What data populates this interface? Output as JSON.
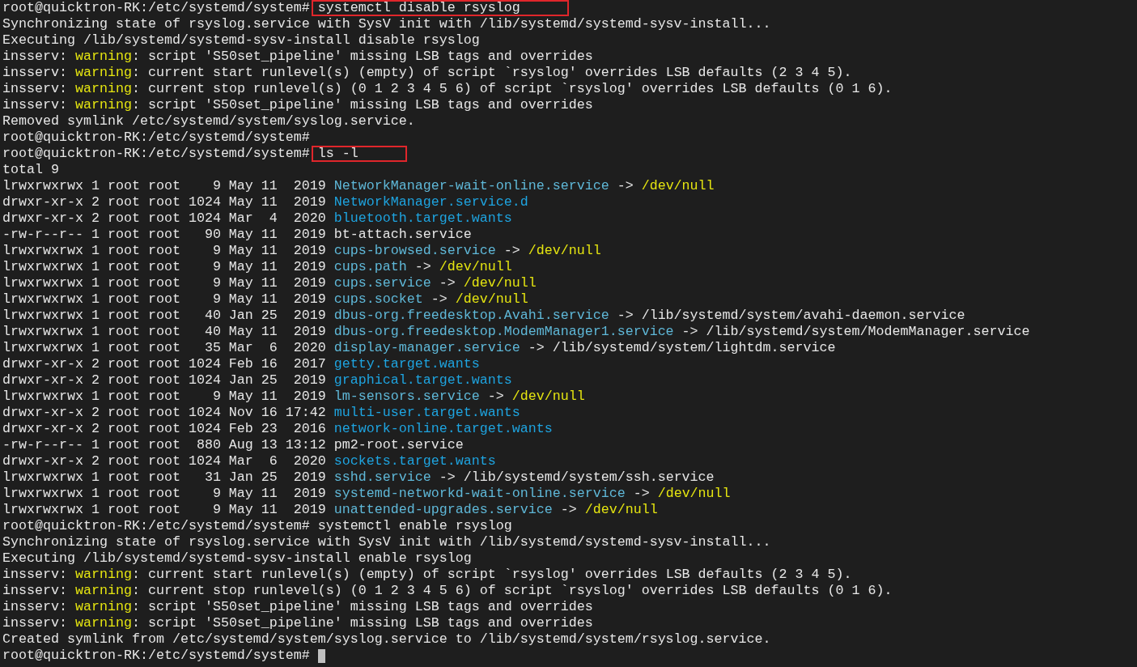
{
  "terminal": {
    "lines": [
      {
        "segments": [
          "root@quicktron-RK:/etc/systemd/system# ",
          {
            "text": "systemctl disable rsyslog",
            "kind": "boxed"
          }
        ]
      },
      {
        "segments": [
          "Synchronizing state of rsyslog.service with SysV init with /lib/systemd/systemd-sysv-install..."
        ]
      },
      {
        "segments": [
          "Executing /lib/systemd/systemd-sysv-install disable rsyslog"
        ]
      },
      {
        "segments": [
          "insserv: ",
          {
            "text": "warning",
            "kind": "warn"
          },
          ": script 'S50set_pipeline' missing LSB tags and overrides"
        ]
      },
      {
        "segments": [
          "insserv: ",
          {
            "text": "warning",
            "kind": "warn"
          },
          ": current start runlevel(s) (empty) of script `rsyslog' overrides LSB defaults (2 3 4 5)."
        ]
      },
      {
        "segments": [
          "insserv: ",
          {
            "text": "warning",
            "kind": "warn"
          },
          ": current stop runlevel(s) (0 1 2 3 4 5 6) of script `rsyslog' overrides LSB defaults (0 1 6)."
        ]
      },
      {
        "segments": [
          "insserv: ",
          {
            "text": "warning",
            "kind": "warn"
          },
          ": script 'S50set_pipeline' missing LSB tags and overrides"
        ]
      },
      {
        "segments": [
          "Removed symlink /etc/systemd/system/syslog.service."
        ]
      },
      {
        "segments": [
          "root@quicktron-RK:/etc/systemd/system#"
        ]
      },
      {
        "segments": [
          "root@quicktron-RK:/etc/systemd/system# ",
          {
            "text": "ls -l",
            "kind": "boxed"
          }
        ]
      },
      {
        "segments": [
          "total 9"
        ]
      },
      {
        "segments": [
          "lrwxrwxrwx 1 root root    9 May 11  2019 ",
          {
            "text": "NetworkManager-wait-online.service",
            "kind": "link"
          },
          " -> ",
          {
            "text": "/dev/null",
            "kind": "target"
          }
        ]
      },
      {
        "segments": [
          "drwxr-xr-x 2 root root 1024 May 11  2019 ",
          {
            "text": "NetworkManager.service.d",
            "kind": "dir"
          }
        ]
      },
      {
        "segments": [
          "drwxr-xr-x 2 root root 1024 Mar  4  2020 ",
          {
            "text": "bluetooth.target.wants",
            "kind": "dir"
          }
        ]
      },
      {
        "segments": [
          "-rw-r--r-- 1 root root   90 May 11  2019 bt-attach.service"
        ]
      },
      {
        "segments": [
          "lrwxrwxrwx 1 root root    9 May 11  2019 ",
          {
            "text": "cups-browsed.service",
            "kind": "link"
          },
          " -> ",
          {
            "text": "/dev/null",
            "kind": "target"
          }
        ]
      },
      {
        "segments": [
          "lrwxrwxrwx 1 root root    9 May 11  2019 ",
          {
            "text": "cups.path",
            "kind": "link"
          },
          " -> ",
          {
            "text": "/dev/null",
            "kind": "target"
          }
        ]
      },
      {
        "segments": [
          "lrwxrwxrwx 1 root root    9 May 11  2019 ",
          {
            "text": "cups.service",
            "kind": "link"
          },
          " -> ",
          {
            "text": "/dev/null",
            "kind": "target"
          }
        ]
      },
      {
        "segments": [
          "lrwxrwxrwx 1 root root    9 May 11  2019 ",
          {
            "text": "cups.socket",
            "kind": "link"
          },
          " -> ",
          {
            "text": "/dev/null",
            "kind": "target"
          }
        ]
      },
      {
        "segments": [
          "lrwxrwxrwx 1 root root   40 Jan 25  2019 ",
          {
            "text": "dbus-org.freedesktop.Avahi.service",
            "kind": "link"
          },
          " -> /lib/systemd/system/avahi-daemon.service"
        ]
      },
      {
        "segments": [
          "lrwxrwxrwx 1 root root   40 May 11  2019 ",
          {
            "text": "dbus-org.freedesktop.ModemManager1.service",
            "kind": "link"
          },
          " -> /lib/systemd/system/ModemManager.service"
        ]
      },
      {
        "segments": [
          "lrwxrwxrwx 1 root root   35 Mar  6  2020 ",
          {
            "text": "display-manager.service",
            "kind": "link"
          },
          " -> /lib/systemd/system/lightdm.service"
        ]
      },
      {
        "segments": [
          "drwxr-xr-x 2 root root 1024 Feb 16  2017 ",
          {
            "text": "getty.target.wants",
            "kind": "dir"
          }
        ]
      },
      {
        "segments": [
          "drwxr-xr-x 2 root root 1024 Jan 25  2019 ",
          {
            "text": "graphical.target.wants",
            "kind": "dir"
          }
        ]
      },
      {
        "segments": [
          "lrwxrwxrwx 1 root root    9 May 11  2019 ",
          {
            "text": "lm-sensors.service",
            "kind": "link"
          },
          " -> ",
          {
            "text": "/dev/null",
            "kind": "target"
          }
        ]
      },
      {
        "segments": [
          "drwxr-xr-x 2 root root 1024 Nov 16 17:42 ",
          {
            "text": "multi-user.target.wants",
            "kind": "dir"
          }
        ]
      },
      {
        "segments": [
          "drwxr-xr-x 2 root root 1024 Feb 23  2016 ",
          {
            "text": "network-online.target.wants",
            "kind": "dir"
          }
        ]
      },
      {
        "segments": [
          "-rw-r--r-- 1 root root  880 Aug 13 13:12 pm2-root.service"
        ]
      },
      {
        "segments": [
          "drwxr-xr-x 2 root root 1024 Mar  6  2020 ",
          {
            "text": "sockets.target.wants",
            "kind": "dir"
          }
        ]
      },
      {
        "segments": [
          "lrwxrwxrwx 1 root root   31 Jan 25  2019 ",
          {
            "text": "sshd.service",
            "kind": "link"
          },
          " -> /lib/systemd/system/ssh.service"
        ]
      },
      {
        "segments": [
          "lrwxrwxrwx 1 root root    9 May 11  2019 ",
          {
            "text": "systemd-networkd-wait-online.service",
            "kind": "link"
          },
          " -> ",
          {
            "text": "/dev/null",
            "kind": "target"
          }
        ]
      },
      {
        "segments": [
          "lrwxrwxrwx 1 root root    9 May 11  2019 ",
          {
            "text": "unattended-upgrades.service",
            "kind": "link"
          },
          " -> ",
          {
            "text": "/dev/null",
            "kind": "target"
          }
        ]
      },
      {
        "segments": [
          "root@quicktron-RK:/etc/systemd/system# systemctl enable rsyslog"
        ]
      },
      {
        "segments": [
          "Synchronizing state of rsyslog.service with SysV init with /lib/systemd/systemd-sysv-install..."
        ]
      },
      {
        "segments": [
          "Executing /lib/systemd/systemd-sysv-install enable rsyslog"
        ]
      },
      {
        "segments": [
          "insserv: ",
          {
            "text": "warning",
            "kind": "warn"
          },
          ": current start runlevel(s) (empty) of script `rsyslog' overrides LSB defaults (2 3 4 5)."
        ]
      },
      {
        "segments": [
          "insserv: ",
          {
            "text": "warning",
            "kind": "warn"
          },
          ": current stop runlevel(s) (0 1 2 3 4 5 6) of script `rsyslog' overrides LSB defaults (0 1 6)."
        ]
      },
      {
        "segments": [
          "insserv: ",
          {
            "text": "warning",
            "kind": "warn"
          },
          ": script 'S50set_pipeline' missing LSB tags and overrides"
        ]
      },
      {
        "segments": [
          "insserv: ",
          {
            "text": "warning",
            "kind": "warn"
          },
          ": script 'S50set_pipeline' missing LSB tags and overrides"
        ]
      },
      {
        "segments": [
          "Created symlink from /etc/systemd/system/syslog.service to /lib/systemd/system/rsyslog.service."
        ]
      },
      {
        "segments": [
          "root@quicktron-RK:/etc/systemd/system# "
        ],
        "cursor": true
      }
    ]
  }
}
